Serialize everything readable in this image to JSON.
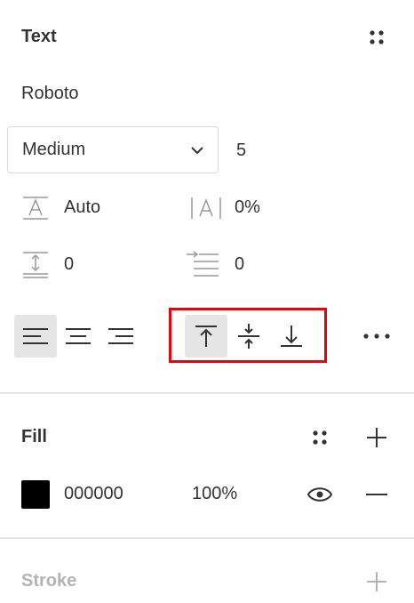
{
  "text_section": {
    "title": "Text",
    "font_family": "Roboto",
    "font_weight": "Medium",
    "font_size": "5",
    "line_height": "Auto",
    "letter_spacing": "0%",
    "paragraph_spacing": "0",
    "paragraph_indent": "0"
  },
  "fill_section": {
    "title": "Fill",
    "color_hex": "000000",
    "opacity": "100%",
    "swatch_color": "#000000"
  },
  "stroke_section": {
    "title": "Stroke"
  },
  "colors": {
    "highlight_border": "#e8000b",
    "active_button_bg": "#e5e5e5",
    "divider": "#e6e6e6",
    "text": "#333333",
    "muted_text": "#b3b3b3"
  }
}
